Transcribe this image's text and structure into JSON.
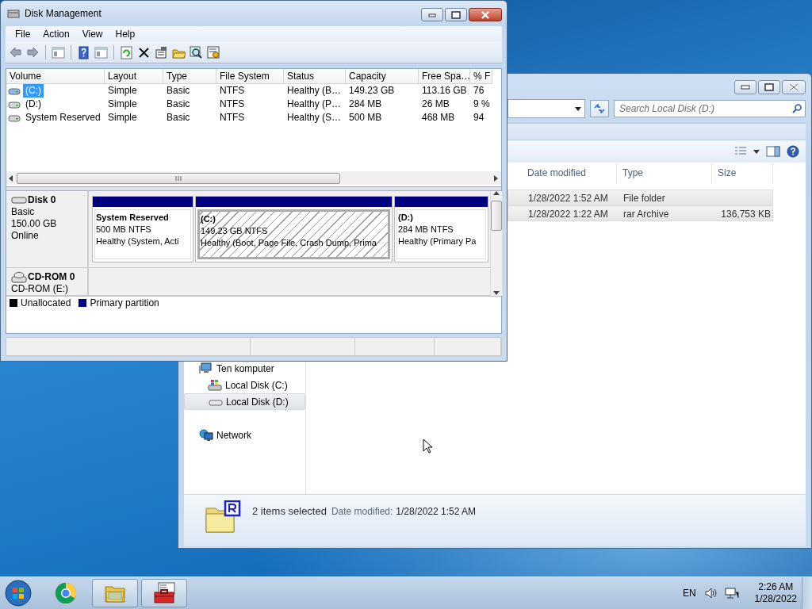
{
  "disk_management": {
    "title": "Disk Management",
    "menu": [
      "File",
      "Action",
      "View",
      "Help"
    ],
    "volume_columns": [
      "Volume",
      "Layout",
      "Type",
      "File System",
      "Status",
      "Capacity",
      "Free Spa…",
      "% F"
    ],
    "volumes": [
      {
        "cells": [
          "(C:)",
          "Simple",
          "Basic",
          "NTFS",
          "Healthy (B…",
          "149.23 GB",
          "113.16 GB",
          "76"
        ],
        "selected": true
      },
      {
        "cells": [
          "(D:)",
          "Simple",
          "Basic",
          "NTFS",
          "Healthy (P…",
          "284 MB",
          "26 MB",
          "9 %"
        ],
        "selected": false
      },
      {
        "cells": [
          "System Reserved",
          "Simple",
          "Basic",
          "NTFS",
          "Healthy (S…",
          "500 MB",
          "468 MB",
          "94"
        ],
        "selected": false
      }
    ],
    "disks": [
      {
        "kind": "disk",
        "name": "Disk 0",
        "lines": [
          "Basic",
          "150.00 GB",
          "Online"
        ],
        "partitions": [
          {
            "kind": "primary",
            "name": "System Reserved",
            "size": "500 MB NTFS",
            "status": "Healthy (System, Acti",
            "selected": false
          },
          {
            "kind": "primary",
            "name": "(C:)",
            "size": "149.23 GB NTFS",
            "status": "Healthy (Boot, Page File, Crash Dump, Prima",
            "selected": true
          },
          {
            "kind": "primary",
            "name": "(D:)",
            "size": "284 MB NTFS",
            "status": "Healthy (Primary Pa",
            "selected": false
          }
        ]
      },
      {
        "kind": "cdrom",
        "name": "CD-ROM 0",
        "lines": [
          "CD-ROM (E:)"
        ]
      }
    ],
    "legend": [
      {
        "kind": "unallocated",
        "label": "Unallocated",
        "color": "#000000"
      },
      {
        "kind": "primary",
        "label": "Primary partition",
        "color": "#00007f"
      }
    ]
  },
  "explorer": {
    "search": {
      "placeholder": "Search Local Disk (D:)"
    },
    "columns": [
      "Date modified",
      "Type",
      "Size"
    ],
    "files": [
      {
        "date": "1/28/2022 1:52 AM",
        "type": "File folder",
        "selected": true
      },
      {
        "date": "1/28/2022 1:22 AM",
        "type": "rar Archive",
        "size": "136,753 KB",
        "selected": true
      }
    ],
    "nav": [
      {
        "kind": "computer",
        "label": "Ten komputer",
        "selected": false,
        "children": [
          {
            "kind": "system-drive",
            "label": "Local Disk (C:)",
            "selected": false
          },
          {
            "kind": "drive",
            "label": "Local Disk (D:)",
            "selected": true
          }
        ]
      },
      {
        "kind": "network",
        "label": "Network",
        "selected": false
      }
    ],
    "details": {
      "count": "2 items selected",
      "date_label": "Date modified:",
      "date": "1/28/2022 1:52 AM"
    }
  },
  "taskbar": {
    "apps": [
      {
        "kind": "chrome",
        "running": false
      },
      {
        "kind": "explorer",
        "running": true
      },
      {
        "kind": "disk-management",
        "running": true
      }
    ],
    "language": "EN",
    "time": "2:26 AM",
    "date": "1/28/2022"
  }
}
